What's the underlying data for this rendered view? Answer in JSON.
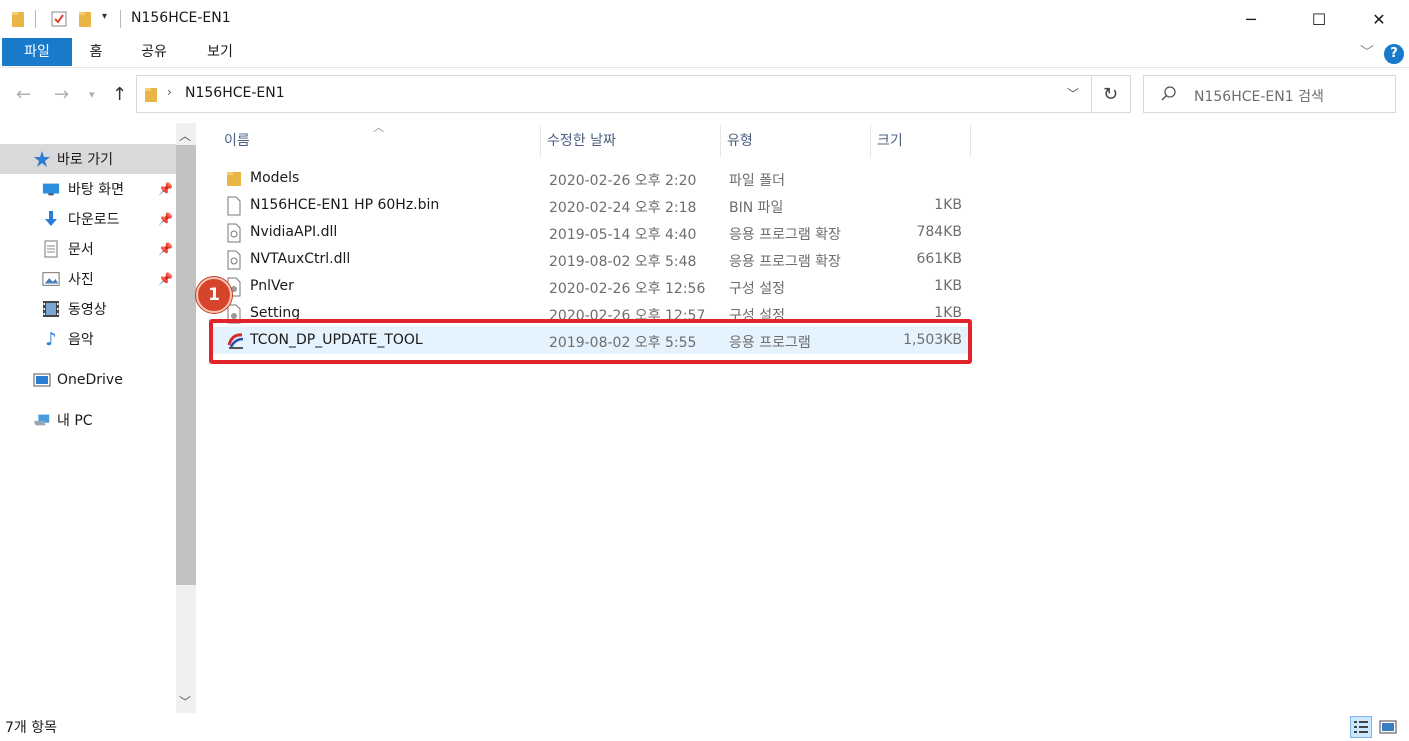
{
  "window": {
    "title": "N156HCE-EN1",
    "minimize_label": "─",
    "maximize_label": "☐",
    "close_label": "✕"
  },
  "ribbon": {
    "tabs": [
      {
        "label": "파일",
        "active": true
      },
      {
        "label": "홈"
      },
      {
        "label": "공유"
      },
      {
        "label": "보기"
      }
    ],
    "help_label": "?"
  },
  "address": {
    "path": "N156HCE-EN1",
    "search_placeholder": "N156HCE-EN1 검색"
  },
  "sidebar": {
    "items": [
      {
        "label": "바로 가기",
        "icon": "star-icon",
        "pinned": false,
        "selected": true
      },
      {
        "label": "바탕 화면",
        "icon": "desktop-icon",
        "pinned": true
      },
      {
        "label": "다운로드",
        "icon": "download-icon",
        "pinned": true
      },
      {
        "label": "문서",
        "icon": "document-icon",
        "pinned": true
      },
      {
        "label": "사진",
        "icon": "picture-icon",
        "pinned": true
      },
      {
        "label": "동영상",
        "icon": "video-icon",
        "pinned": false
      },
      {
        "label": "음악",
        "icon": "music-icon",
        "pinned": false
      },
      {
        "label": "OneDrive",
        "icon": "onedrive-icon",
        "pinned": false
      },
      {
        "label": "내 PC",
        "icon": "pc-icon",
        "pinned": false
      }
    ]
  },
  "columns": {
    "name": "이름",
    "date": "수정한 날짜",
    "type": "유형",
    "size": "크기"
  },
  "files": [
    {
      "name": "Models",
      "date": "2020-02-26 오후 2:20",
      "type": "파일 폴더",
      "size": "",
      "icon": "folder-icon"
    },
    {
      "name": "N156HCE-EN1 HP 60Hz.bin",
      "date": "2020-02-24 오후 2:18",
      "type": "BIN 파일",
      "size": "1KB",
      "icon": "file-icon"
    },
    {
      "name": "NvidiaAPI.dll",
      "date": "2019-05-14 오후 4:40",
      "type": "응용 프로그램 확장",
      "size": "784KB",
      "icon": "dll-icon"
    },
    {
      "name": "NVTAuxCtrl.dll",
      "date": "2019-08-02 오후 5:48",
      "type": "응용 프로그램 확장",
      "size": "661KB",
      "icon": "dll-icon"
    },
    {
      "name": "PnlVer",
      "date": "2020-02-26 오후 12:56",
      "type": "구성 설정",
      "size": "1KB",
      "icon": "config-icon"
    },
    {
      "name": "Setting",
      "date": "2020-02-26 오후 12:57",
      "type": "구성 설정",
      "size": "1KB",
      "icon": "config-icon"
    },
    {
      "name": "TCON_DP_UPDATE_TOOL",
      "date": "2019-08-02 오후 5:55",
      "type": "응용 프로그램",
      "size": "1,503KB",
      "icon": "app-icon",
      "selected": true
    }
  ],
  "annotation": {
    "step_number": "1",
    "highlight_color": "#e2232b"
  },
  "status": {
    "item_count": "7개 항목"
  },
  "colors": {
    "accent": "#1979ca",
    "selection": "#e5f3ff",
    "badge": "#d6452a"
  }
}
